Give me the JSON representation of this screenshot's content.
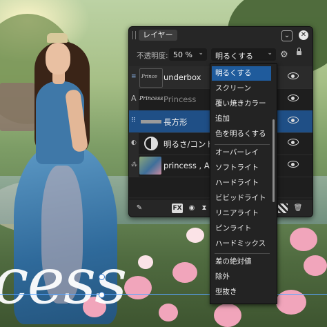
{
  "panel": {
    "tab_label": "レイヤー",
    "collapse_glyph": "⌄",
    "close_glyph": "✕",
    "opacity_label": "不透明度:",
    "opacity_value": "50 %",
    "blend_value": "明るくする"
  },
  "layers": [
    {
      "name": "underbox",
      "thumb_label": "Prince",
      "gutter": "≡"
    },
    {
      "name": "Princess",
      "thumb_label": "Princess",
      "gutter": "A"
    },
    {
      "name": "長方形",
      "thumb_label": "",
      "gutter": "⠿"
    },
    {
      "name": "明るさ/コントラ",
      "thumb_label": "",
      "gutter": "◐"
    },
    {
      "name": "princess , A h",
      "thumb_label": "",
      "gutter": "⁂"
    }
  ],
  "footer": {
    "fx_label": "FX"
  },
  "blend_menu": {
    "items": [
      "明るくする",
      "スクリーン",
      "覆い焼きカラー",
      "追加",
      "色を明るくする",
      "オーバーレイ",
      "ソフトライト",
      "ハードライト",
      "ビビッドライト",
      "リニアライト",
      "ピンライト",
      "ハードミックス",
      "差の絶対値",
      "除外",
      "型抜き"
    ],
    "selected": "明るくする"
  },
  "canvas": {
    "text": "cess"
  },
  "colors": {
    "accent": "#1f5b9c",
    "panel_bg": "#262626"
  }
}
